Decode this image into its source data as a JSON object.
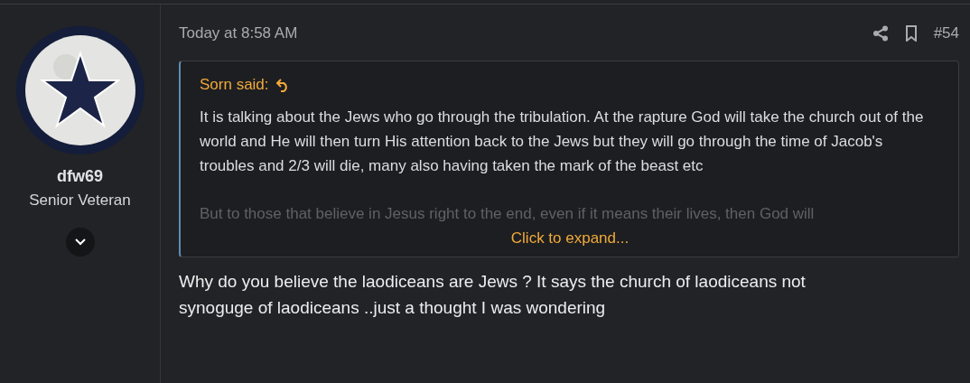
{
  "user": {
    "name": "dfw69",
    "title": "Senior Veteran"
  },
  "post": {
    "time": "Today at 8:58 AM",
    "number": "#54",
    "quote": {
      "author": "Sorn said:",
      "paragraphs": [
        "It is talking about the Jews who go through the tribulation. At the rapture God will take the church out of the world and He will then turn His attention back to the Jews but they will go through the time of Jacob's troubles and 2/3 will die, many also having taken the mark of the beast etc",
        "But to those that believe in Jesus right to the end, even if it means their lives, then God will"
      ],
      "expand": "Click to expand..."
    },
    "body": [
      "Why do you believe the laodiceans are Jews ? It says the church of laodiceans not",
      "synoguge of laodiceans ..just a thought I was wondering"
    ]
  }
}
